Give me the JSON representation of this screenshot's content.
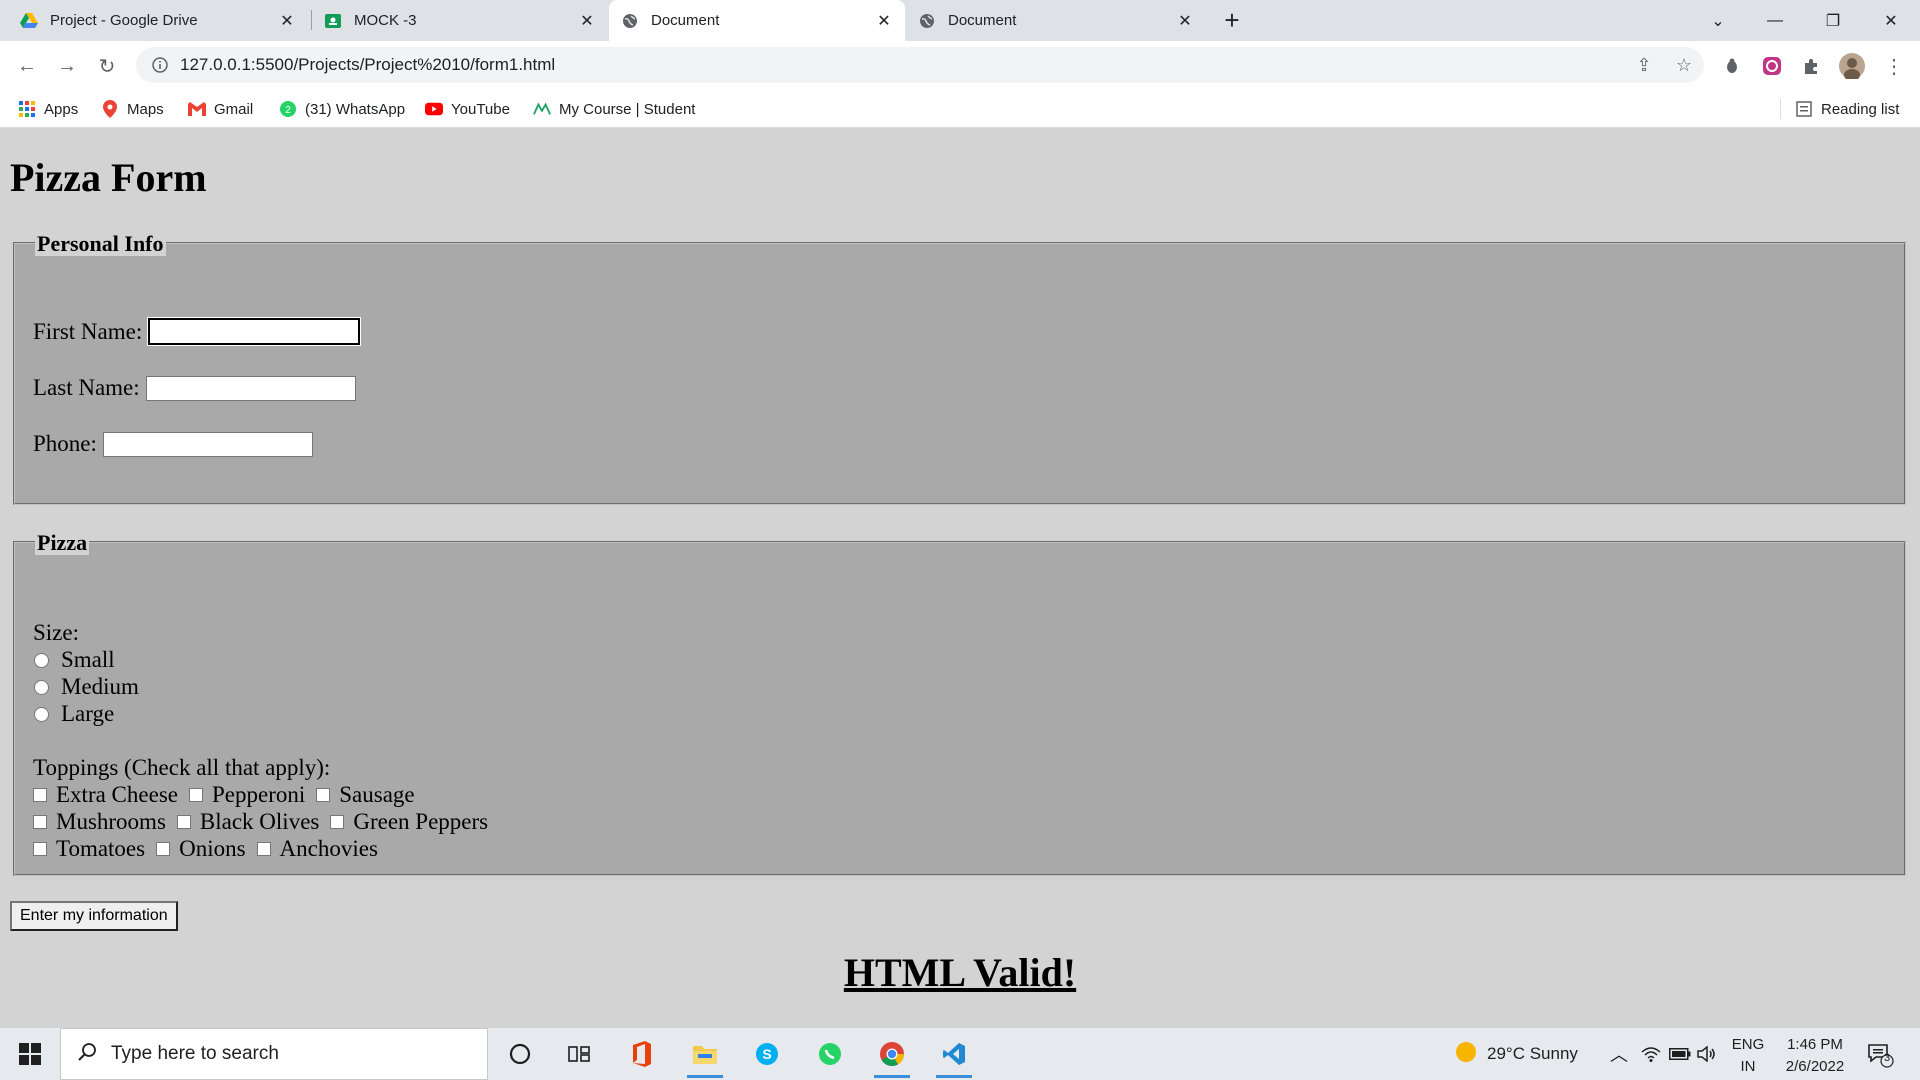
{
  "browser": {
    "tabs": [
      {
        "title": "Project - Google Drive",
        "icon": "google-drive-icon"
      },
      {
        "title": "MOCK -3",
        "icon": "google-classroom-icon"
      },
      {
        "title": "Document",
        "icon": "globe-icon"
      },
      {
        "title": "Document",
        "icon": "globe-icon"
      }
    ],
    "url": "127.0.0.1:5500/Projects/Project%2010/form1.html",
    "bookmarks": [
      {
        "label": "Apps",
        "icon": "apps-grid-icon"
      },
      {
        "label": "Maps",
        "icon": "maps-pin-icon"
      },
      {
        "label": "Gmail",
        "icon": "gmail-icon"
      },
      {
        "label": "(31) WhatsApp",
        "icon": "whatsapp-icon"
      },
      {
        "label": "YouTube",
        "icon": "youtube-icon"
      },
      {
        "label": "My Course | Student",
        "icon": "course-icon"
      }
    ],
    "reading_list": "Reading list"
  },
  "page": {
    "title": "Pizza Form",
    "personal": {
      "legend": "Personal Info",
      "first_name_label": "First Name:",
      "last_name_label": "Last Name:",
      "phone_label": "Phone:"
    },
    "pizza": {
      "legend": "Pizza",
      "size_label": "Size:",
      "sizes": [
        "Small",
        "Medium",
        "Large"
      ],
      "toppings_label": "Toppings (Check all that apply):",
      "toppings": [
        [
          "Extra Cheese",
          "Pepperoni",
          "Sausage"
        ],
        [
          "Mushrooms",
          "Black Olives",
          "Green Peppers"
        ],
        [
          "Tomatoes",
          "Onions",
          "Anchovies"
        ]
      ]
    },
    "submit_label": "Enter my information",
    "valid_text": "HTML Valid!"
  },
  "taskbar": {
    "search_placeholder": "Type here to search",
    "weather": "29°C  Sunny",
    "lang_top": "ENG",
    "lang_bottom": "IN",
    "time": "1:46 PM",
    "date": "2/6/2022",
    "notification_count": "3"
  }
}
